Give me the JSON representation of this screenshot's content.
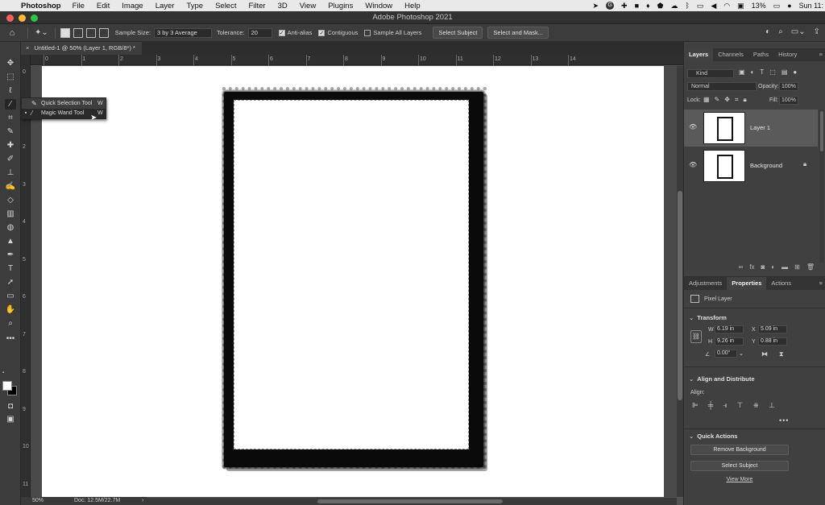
{
  "menubar": {
    "app": "Photoshop",
    "items": [
      "File",
      "Edit",
      "Image",
      "Layer",
      "Type",
      "Select",
      "Filter",
      "3D",
      "View",
      "Plugins",
      "Window",
      "Help"
    ],
    "battery": "13%",
    "clock": "Sun 11:"
  },
  "window": {
    "title": "Adobe Photoshop 2021"
  },
  "options": {
    "sample_size_label": "Sample Size:",
    "sample_size_value": "3 by 3 Average",
    "tolerance_label": "Tolerance:",
    "tolerance_value": "20",
    "anti_alias": "Anti-alias",
    "contiguous": "Contiguous",
    "sample_all_layers": "Sample All Layers",
    "select_subject": "Select Subject",
    "select_and_mask": "Select and Mask..."
  },
  "document_tab": {
    "title": "Untitled-1 @ 50% (Layer 1, RGB/8*) *",
    "close": "×"
  },
  "ruler": {
    "h_labels": [
      "0",
      "1",
      "2",
      "3",
      "4",
      "5",
      "6",
      "7",
      "8",
      "9",
      "10",
      "11",
      "12",
      "13",
      "14"
    ],
    "v_labels": [
      "0",
      "1",
      "2",
      "3",
      "4",
      "5",
      "6",
      "7",
      "8",
      "9",
      "10",
      "11"
    ]
  },
  "flyout": {
    "items": [
      {
        "name": "Quick Selection Tool",
        "key": "W"
      },
      {
        "name": "Magic Wand Tool",
        "key": "W"
      }
    ]
  },
  "status": {
    "zoom": "50%",
    "doc": "Doc: 12.5M/22.7M",
    "arrow": "›"
  },
  "layers_panel": {
    "tabs": [
      "Layers",
      "Channels",
      "Paths",
      "History"
    ],
    "kind": "Kind",
    "blend": "Normal",
    "opacity_label": "Opacity:",
    "opacity_value": "100%",
    "lock_label": "Lock:",
    "fill_label": "Fill:",
    "fill_value": "100%",
    "layers": [
      {
        "name": "Layer 1"
      },
      {
        "name": "Background"
      }
    ]
  },
  "props_panel": {
    "tabs": [
      "Adjustments",
      "Properties",
      "Actions"
    ],
    "pixel_layer": "Pixel Layer",
    "transform": "Transform",
    "w_label": "W",
    "w_value": "6.19 in",
    "x_label": "X",
    "x_value": "5.09 in",
    "h_label": "H",
    "h_value": "9.26 in",
    "y_label": "Y",
    "y_value": "0.88 in",
    "angle_value": "0.00°",
    "align_section": "Align and Distribute",
    "align_label": "Align:",
    "quick_actions": "Quick Actions",
    "remove_bg": "Remove Background",
    "select_subject": "Select Subject",
    "view_more": "View More"
  },
  "colors": {
    "accent": "#2d8cf0",
    "panel": "#404040",
    "canvas": "#ffffff"
  }
}
